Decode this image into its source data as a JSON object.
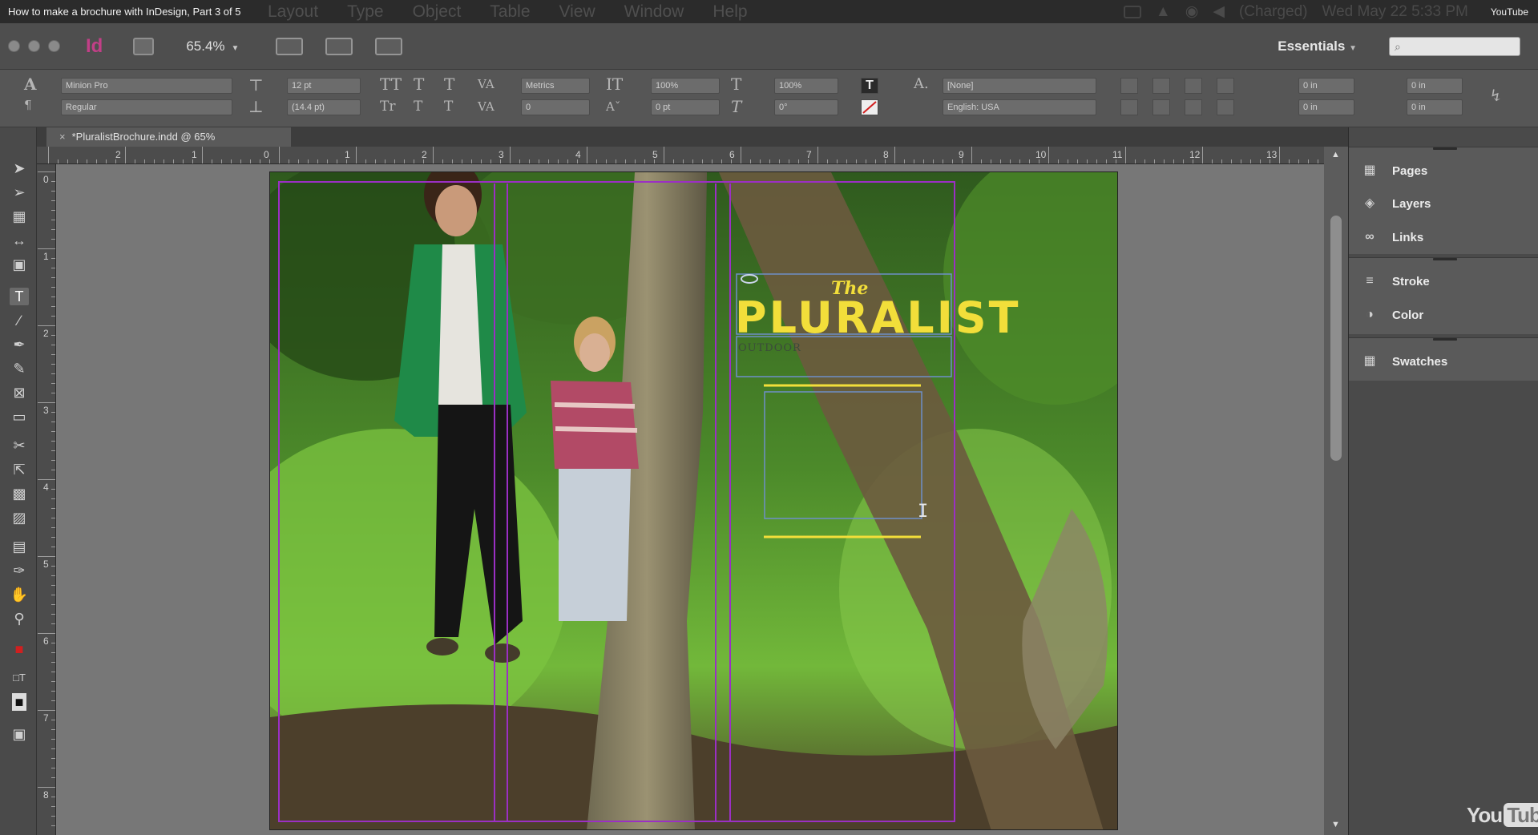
{
  "video": {
    "title": "How to make a brochure with InDesign, Part 3 of 5",
    "source_tag": "YouTube"
  },
  "menubar": {
    "menus": [
      "Layout",
      "Type",
      "Object",
      "Table",
      "View",
      "Window",
      "Help"
    ],
    "status": {
      "battery": "(Charged)",
      "datetime": "Wed May 22  5:33 PM"
    }
  },
  "appbar": {
    "app_logo": "Id",
    "zoom": "65.4%",
    "workspace": "Essentials",
    "search_placeholder": "⌕"
  },
  "control_panel": {
    "font_family": "Minion Pro",
    "font_style": "Regular",
    "font_size": "12 pt",
    "leading": "(14.4 pt)",
    "kerning": "Metrics",
    "tracking": "0",
    "vertical_scale": "100%",
    "horizontal_scale": "100%",
    "baseline_shift": "0 pt",
    "skew": "0°",
    "char_style": "[None]",
    "language": "English: USA",
    "indent_left": "0 in",
    "indent_right": "0 in",
    "indent_first": "0 in",
    "indent_last": "0 in"
  },
  "document": {
    "tab_label": "*PluralistBrochure.indd @ 65%",
    "h_ruler_labels": [
      "2",
      "1",
      "0",
      "1",
      "2",
      "3",
      "4",
      "5",
      "6",
      "7",
      "8",
      "9",
      "10",
      "11",
      "12",
      "13"
    ],
    "v_ruler_labels": [
      "0",
      "1",
      "2",
      "3",
      "4",
      "5",
      "6",
      "7",
      "8"
    ]
  },
  "brochure": {
    "title_small": "The",
    "title_big": "PLURALIST",
    "subtitle": "OUTDOOR"
  },
  "panels": [
    {
      "label": "Pages",
      "icon": "pages-icon"
    },
    {
      "label": "Layers",
      "icon": "layers-icon"
    },
    {
      "label": "Links",
      "icon": "links-icon"
    },
    {
      "label": "Stroke",
      "icon": "stroke-icon"
    },
    {
      "label": "Color",
      "icon": "color-icon"
    },
    {
      "label": "Swatches",
      "icon": "swatches-icon"
    }
  ],
  "watermark": {
    "you": "You",
    "tube": "Tube"
  },
  "colors": {
    "title_yellow": "#f2de3a",
    "frame_purple": "#9b2fc4",
    "guide_blue": "#6e8fc8"
  }
}
